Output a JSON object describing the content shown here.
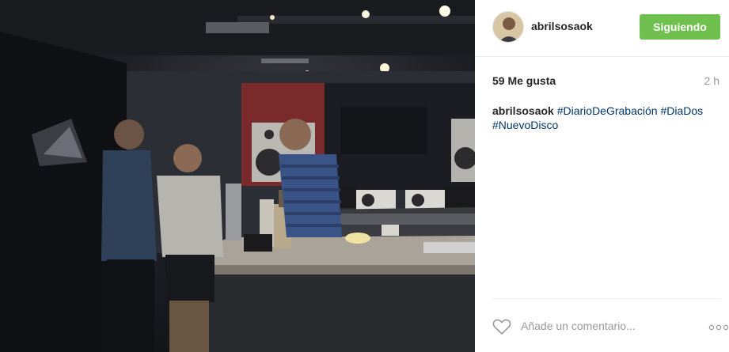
{
  "post": {
    "image_alt": "",
    "username": "abrilsosaok",
    "follow_button": "Siguiendo",
    "likes": "59 Me gusta",
    "time_ago": "2 h",
    "caption_user": "abrilsosaok",
    "hashtags": [
      "#DiarioDeGrabación",
      "#DiaDos",
      "#NuevoDisco"
    ],
    "comment_placeholder": "Añade un comentario...",
    "icons": {
      "like": "heart-icon",
      "options": "more-options-icon"
    },
    "colors": {
      "follow_button": "#70c050",
      "hashtag": "#003569",
      "muted": "#999999"
    }
  }
}
